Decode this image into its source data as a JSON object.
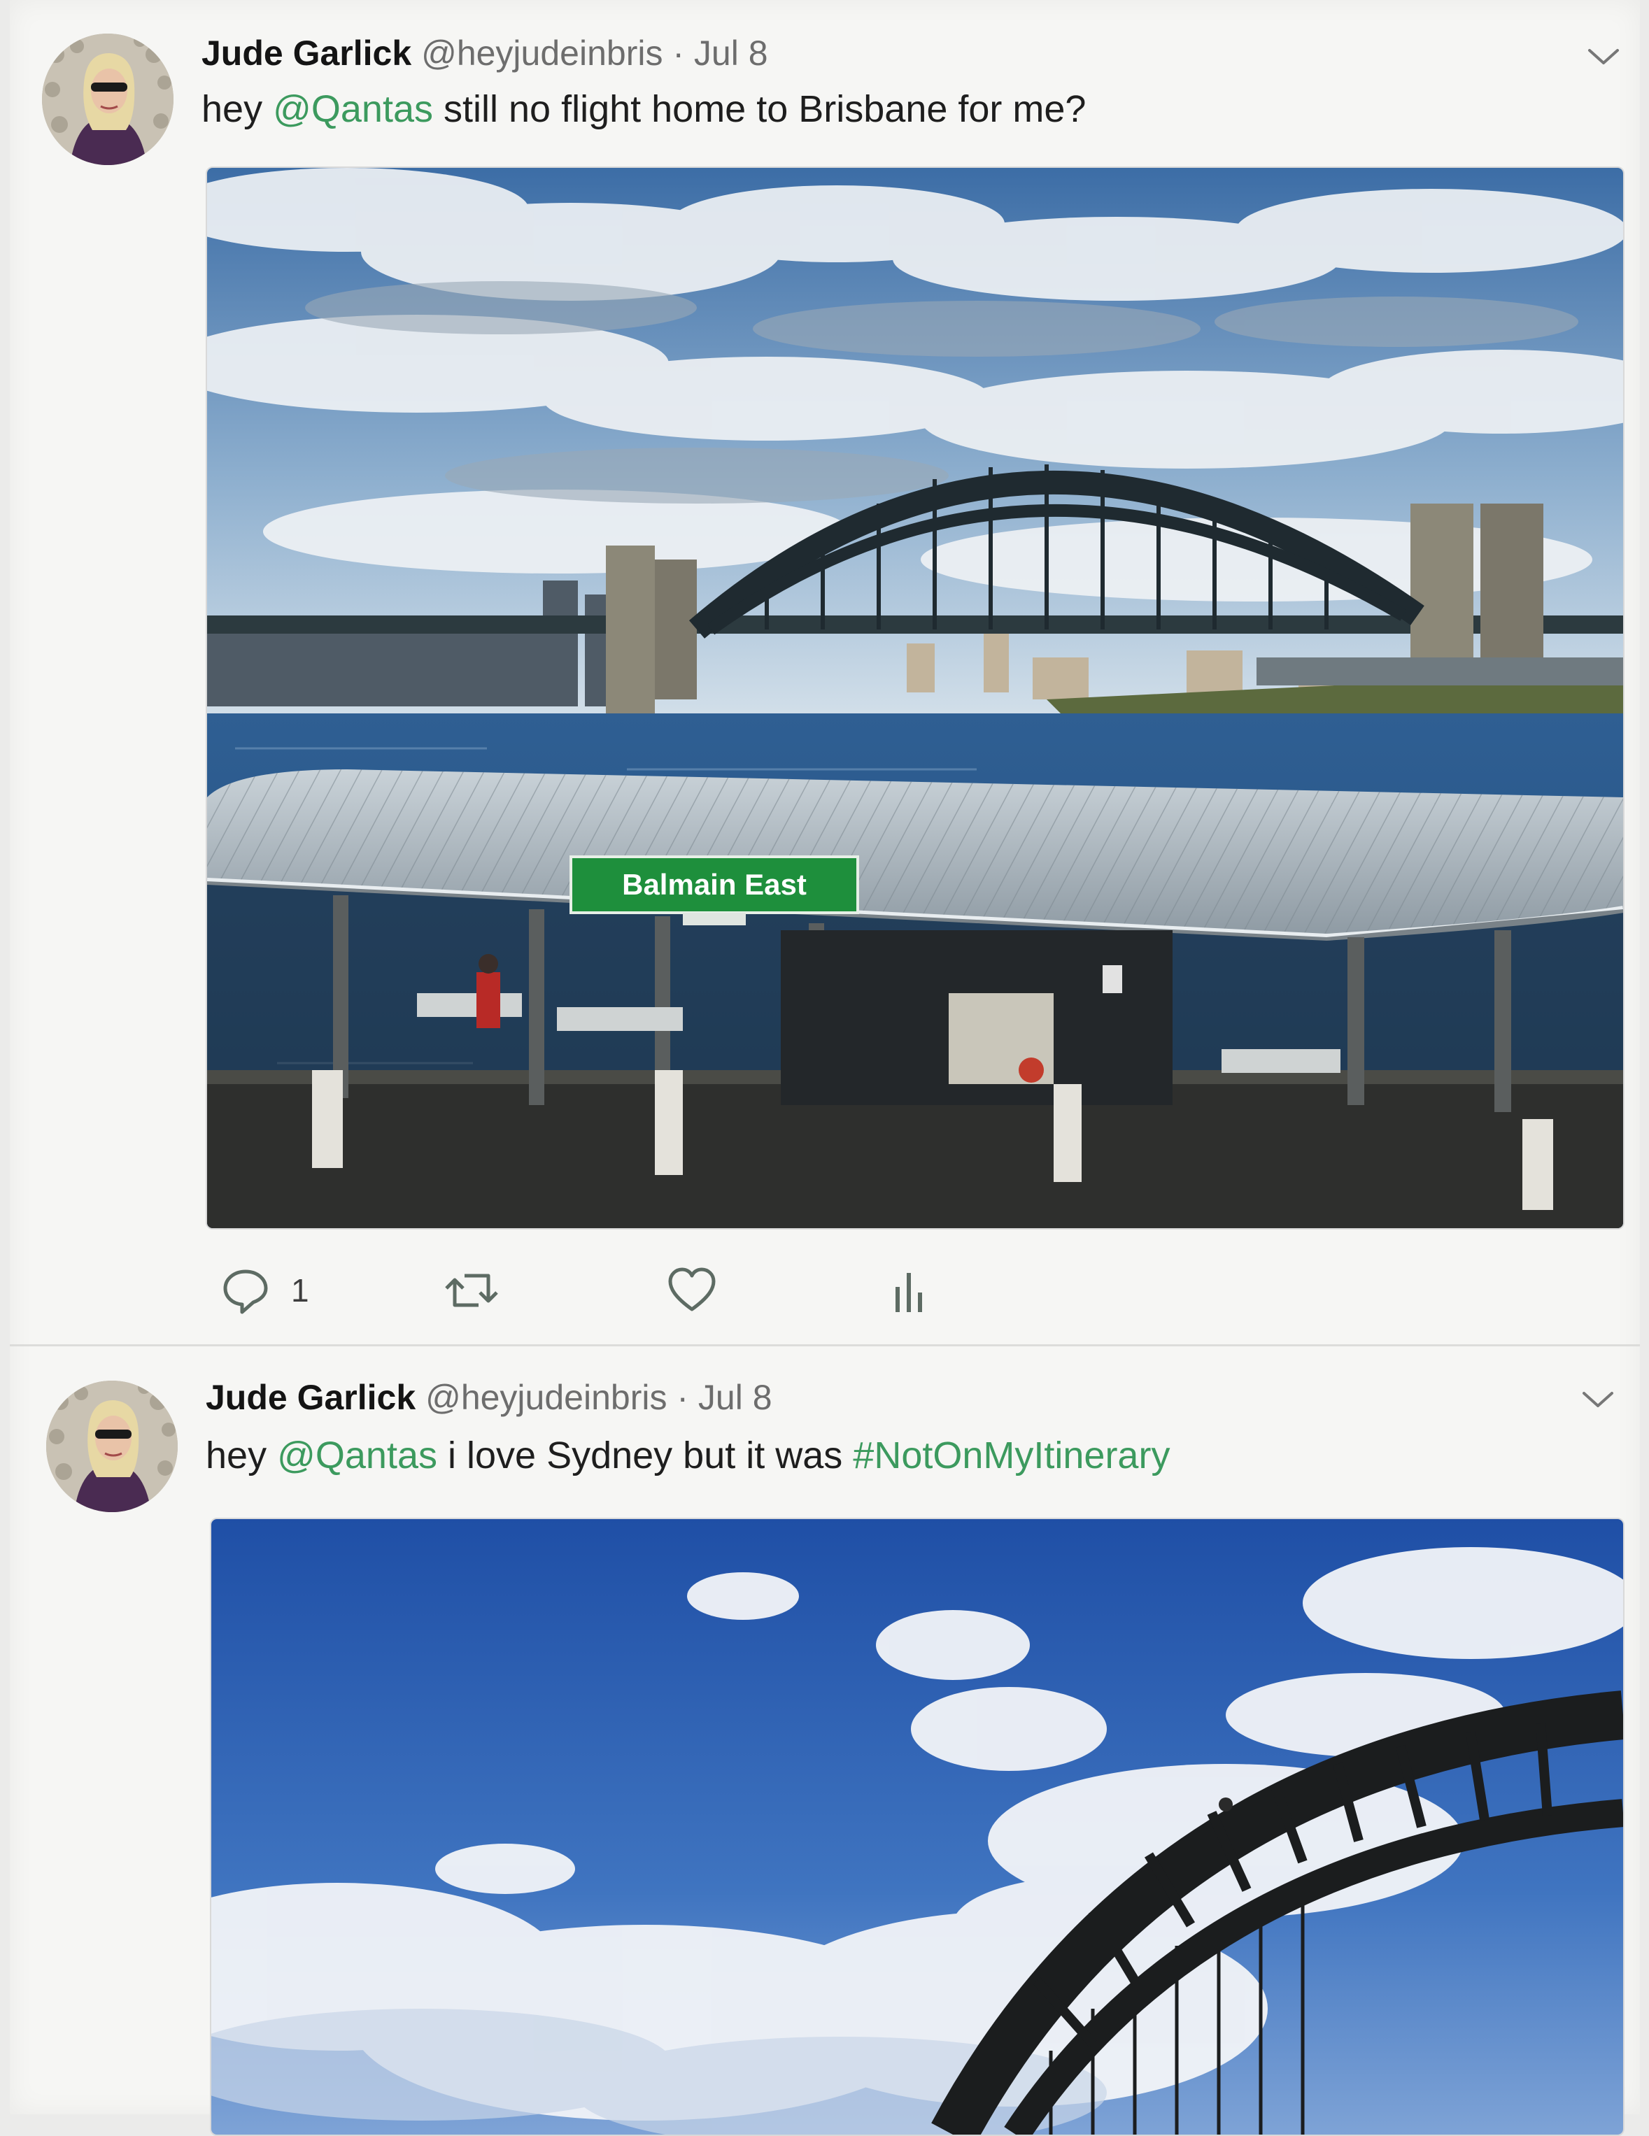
{
  "tweets": [
    {
      "author_name": "Jude Garlick",
      "handle": "@heyjudeinbris",
      "separator": "·",
      "date": "Jul 8",
      "text_before": "hey ",
      "mention": "@Qantas",
      "text_after": " still no flight home to Brisbane for me?",
      "image_sign_text": "Balmain East",
      "reply_count": "1"
    },
    {
      "author_name": "Jude Garlick",
      "handle": "@heyjudeinbris",
      "separator": "·",
      "date": "Jul 8",
      "text_before": "hey ",
      "mention": "@Qantas",
      "text_middle": " i love Sydney but it was ",
      "hashtag": "#NotOnMyItinerary"
    }
  ],
  "colors": {
    "link": "#3c9a5e",
    "sign_green": "#1e8f3c",
    "icon_grey": "#5d6b63"
  },
  "icons": [
    "chevron-down-icon",
    "reply-icon",
    "retweet-icon",
    "like-icon",
    "analytics-icon"
  ]
}
